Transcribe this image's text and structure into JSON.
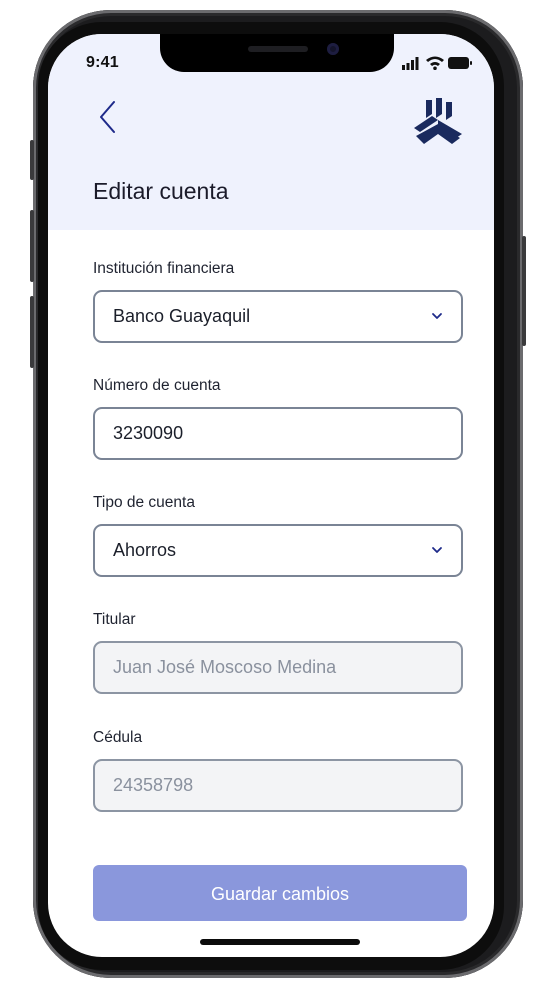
{
  "status_bar": {
    "time": "9:41"
  },
  "header": {
    "title": "Editar cuenta"
  },
  "form": {
    "institution": {
      "label": "Institución financiera",
      "value": "Banco Guayaquil"
    },
    "account_number": {
      "label": "Número de cuenta",
      "value": "3230090"
    },
    "account_type": {
      "label": "Tipo de cuenta",
      "value": "Ahorros"
    },
    "holder": {
      "label": "Titular",
      "value": "Juan José Moscoso Medina"
    },
    "id_number": {
      "label": "Cédula",
      "value": "24358798"
    }
  },
  "actions": {
    "save_label": "Guardar cambios"
  },
  "colors": {
    "header_bg": "#eff2fd",
    "accent": "#1e2a8a",
    "button_disabled": "#8a97dc"
  },
  "icons": [
    "back-chevron-icon",
    "brand-logo-icon",
    "dropdown-chevron-icon",
    "signal-icon",
    "wifi-icon",
    "battery-icon"
  ]
}
